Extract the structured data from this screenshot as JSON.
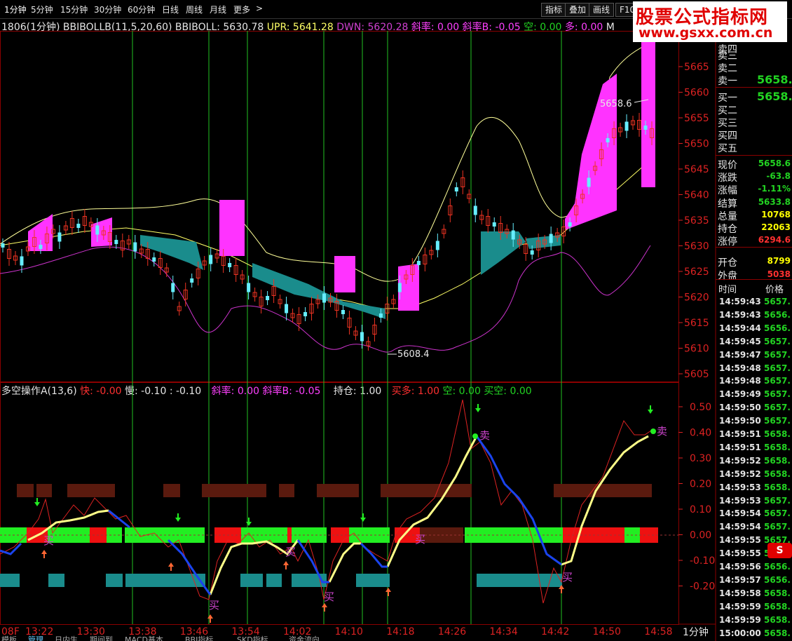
{
  "timeframes": [
    "1分钟",
    "5分钟",
    "15分钟",
    "30分钟",
    "60分钟",
    "日线",
    "周线",
    "月线",
    "更多"
  ],
  "more_arrow": ">",
  "toolbar_buttons": [
    "指标",
    "叠加",
    "画线",
    "F10"
  ],
  "logo": {
    "line1": "股票公式指标网",
    "line2": "www.gsxx.com.cn"
  },
  "main_indicator": {
    "symbol": "1806(1分钟)",
    "name": "BBIBOLLB(11,5,20,60)",
    "bbiboll": "BBIBOLL: 5630.78",
    "upr": "UPR: 5641.28",
    "dwn": "DWN: 5620.28",
    "slope": "斜率: 0.00",
    "slope_b": "斜率B: -0.05",
    "kong": "空: 0.00",
    "duo": "多: 0.00",
    "tail": "M"
  },
  "sub_indicator": {
    "name": "多空操作A(13,6)",
    "fast": "快: -0.00",
    "slow": "慢: -0.10",
    "slow_extra": ": -0.10",
    "slope": "斜率: 0.00",
    "slope_b": "斜率B: -0.05",
    "hold": "持仓: 1.00",
    "buy_duo": "买多: 1.00",
    "kong": "空: 0.00",
    "buy_kong": "买空: 0.00"
  },
  "price_axis_labels": [
    "5665",
    "5660",
    "5655",
    "5650",
    "5645",
    "5640",
    "5635",
    "5630",
    "5625",
    "5620",
    "5615",
    "5610",
    "5605"
  ],
  "sub_axis_labels": [
    "0.50",
    "0.40",
    "0.30",
    "0.20",
    "0.10",
    "0.00",
    "-0.10",
    "-0.20"
  ],
  "time_axis_labels": [
    "08F",
    "13:22",
    "13:30",
    "13:38",
    "13:46",
    "13:54",
    "14:02",
    "14:10",
    "14:18",
    "14:26",
    "14:34",
    "14:42",
    "14:50",
    "14:58"
  ],
  "period_label": "1分钟",
  "price_annotations": {
    "high": "5658.6",
    "low": "5608.4"
  },
  "signal_labels": {
    "buy": "买",
    "sell": "卖"
  },
  "order_book": {
    "sell": [
      {
        "label": "卖四",
        "value": ""
      },
      {
        "label": "卖三",
        "value": ""
      },
      {
        "label": "卖二",
        "value": ""
      },
      {
        "label": "卖一",
        "value": "5658."
      }
    ],
    "buy": [
      {
        "label": "买一",
        "value": "5658."
      },
      {
        "label": "买二",
        "value": ""
      },
      {
        "label": "买三",
        "value": ""
      },
      {
        "label": "买四",
        "value": ""
      },
      {
        "label": "买五",
        "value": ""
      }
    ]
  },
  "quote": [
    {
      "label": "现价",
      "value": "5658.6",
      "color": "#22d322"
    },
    {
      "label": "涨跌",
      "value": "-63.8",
      "color": "#22d322"
    },
    {
      "label": "涨幅",
      "value": "-1.11%",
      "color": "#22d322"
    },
    {
      "label": "结算",
      "value": "5633.8",
      "color": "#22d322"
    },
    {
      "label": "总量",
      "value": "10768",
      "color": "#ffff00"
    },
    {
      "label": "持仓",
      "value": "22063",
      "color": "#ffff00"
    },
    {
      "label": "涨停",
      "value": "6294.6",
      "color": "#ff3030"
    },
    {
      "label": "开仓",
      "value": "8799",
      "color": "#ffff00"
    },
    {
      "label": "外盘",
      "value": "5038",
      "color": "#ff3030"
    }
  ],
  "ticks_header": {
    "time": "时间",
    "price": "价格"
  },
  "ticks": [
    {
      "time": "14:59:43",
      "price": "5657."
    },
    {
      "time": "14:59:43",
      "price": "5656."
    },
    {
      "time": "14:59:44",
      "price": "5656."
    },
    {
      "time": "14:59:45",
      "price": "5657."
    },
    {
      "time": "14:59:47",
      "price": "5657."
    },
    {
      "time": "14:59:48",
      "price": "5657."
    },
    {
      "time": "14:59:48",
      "price": "5657."
    },
    {
      "time": "14:59:49",
      "price": "5657."
    },
    {
      "time": "14:59:50",
      "price": "5657."
    },
    {
      "time": "14:59:50",
      "price": "5657."
    },
    {
      "time": "14:59:51",
      "price": "5658."
    },
    {
      "time": "14:59:51",
      "price": "5658."
    },
    {
      "time": "14:59:52",
      "price": "5658."
    },
    {
      "time": "14:59:52",
      "price": "5658."
    },
    {
      "time": "14:59:53",
      "price": "5658."
    },
    {
      "time": "14:59:53",
      "price": "5657."
    },
    {
      "time": "14:59:54",
      "price": "5657."
    },
    {
      "time": "14:59:54",
      "price": "5657."
    },
    {
      "time": "14:59:55",
      "price": "5657."
    },
    {
      "time": "14:59:55",
      "price": "5657."
    },
    {
      "time": "14:59:56",
      "price": "5656."
    },
    {
      "time": "14:59:57",
      "price": "5656."
    },
    {
      "time": "14:59:58",
      "price": "5658."
    },
    {
      "time": "14:59:59",
      "price": "5658."
    },
    {
      "time": "14:59:59",
      "price": "5658."
    },
    {
      "time": "15:00:00",
      "price": "5658."
    }
  ],
  "bottom_tabs": [
    "模板",
    "管理",
    "日内生",
    "期间到",
    "MACD基本",
    "BBI指标",
    "SKD指标",
    "资金流向"
  ]
}
